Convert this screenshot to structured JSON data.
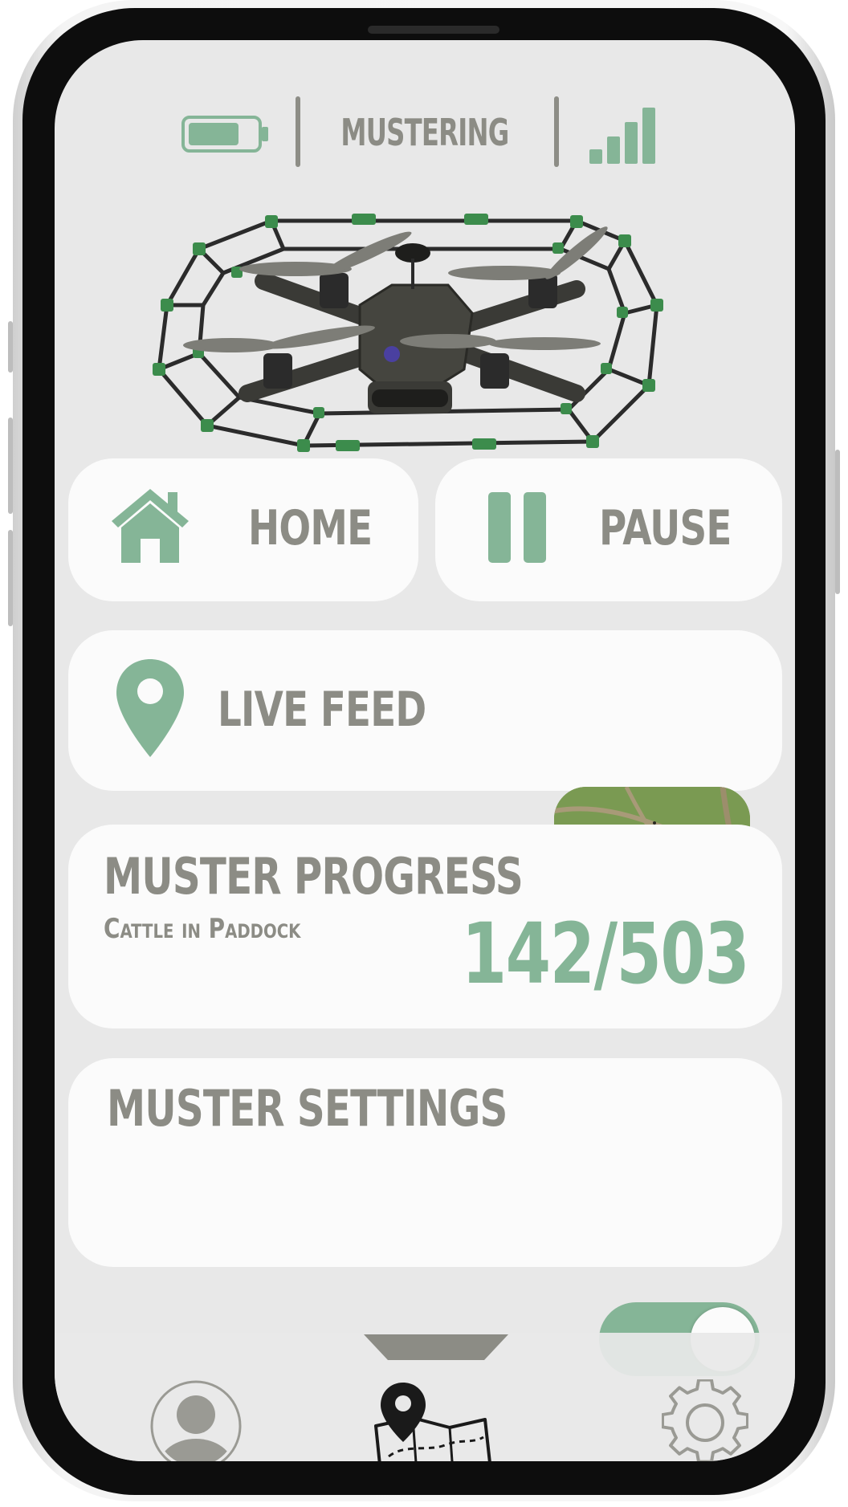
{
  "status_bar": {
    "mode": "MUSTERING",
    "battery_level": 0.75,
    "signal_bars": 4,
    "battery_icon": "battery-icon",
    "signal_icon": "signal-strength-icon"
  },
  "hero": {
    "image": "drone-icon"
  },
  "actions": {
    "home_label": "HOME",
    "pause_label": "PAUSE",
    "home_icon": "house-icon",
    "pause_icon": "pause-icon"
  },
  "live_feed": {
    "label": "LIVE FEED",
    "icon": "map-pin-icon",
    "thumbnail": "aerial-paddock-thumbnail"
  },
  "progress": {
    "title": "MUSTER PROGRESS",
    "subtitle": "Cattle in Paddock",
    "count_text": "142/503",
    "mustered": 142,
    "total": 503
  },
  "settings": {
    "title": "MUSTER SETTINGS",
    "toggle_on": true
  },
  "nav": {
    "profile_icon": "user-icon",
    "map_icon": "map-icon",
    "settings_icon": "gear-icon"
  },
  "colors": {
    "accent": "#85b597",
    "text": "#8c8c85",
    "card": "#fbfbfb",
    "screen": "#e8e8e8"
  }
}
